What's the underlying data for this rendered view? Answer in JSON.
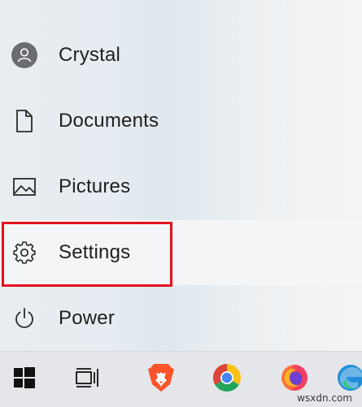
{
  "start_menu": {
    "items": [
      {
        "label": "Crystal",
        "icon": "avatar-icon"
      },
      {
        "label": "Documents",
        "icon": "document-icon"
      },
      {
        "label": "Pictures",
        "icon": "pictures-icon"
      },
      {
        "label": "Settings",
        "icon": "gear-icon",
        "selected": true,
        "highlighted": true
      },
      {
        "label": "Power",
        "icon": "power-icon"
      }
    ]
  },
  "taskbar": {
    "items": [
      {
        "icon": "windows-start-icon"
      },
      {
        "icon": "task-view-icon"
      },
      {
        "icon": "brave-browser-icon"
      },
      {
        "icon": "chrome-icon"
      },
      {
        "icon": "firefox-icon"
      },
      {
        "icon": "edge-icon"
      }
    ]
  },
  "watermark": "wsxdn.com",
  "colors": {
    "highlight": "#e3121e",
    "menu_background": "#e9edf1",
    "taskbar_background": "#e4e6e9"
  }
}
